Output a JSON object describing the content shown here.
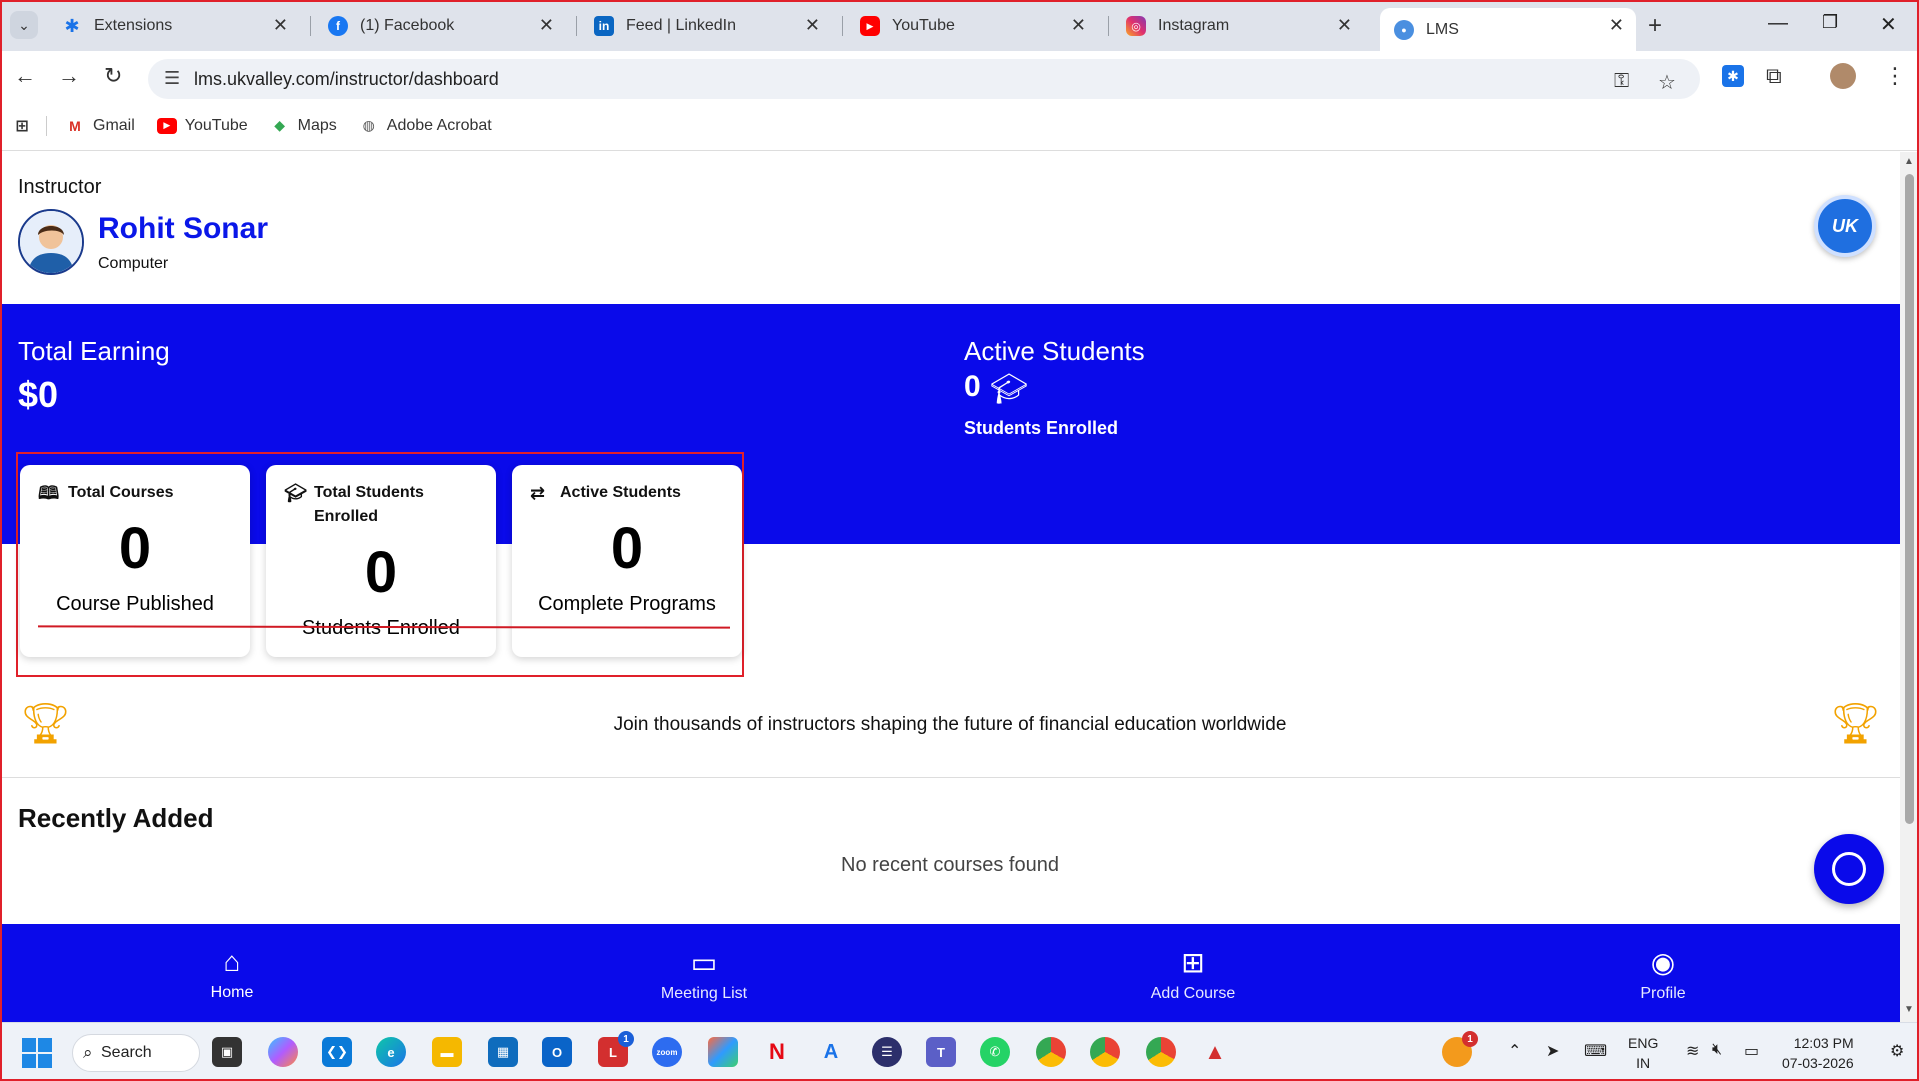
{
  "browser": {
    "tabs": [
      {
        "label": "Extensions"
      },
      {
        "label": "(1) Facebook"
      },
      {
        "label": "Feed | LinkedIn"
      },
      {
        "label": "YouTube"
      },
      {
        "label": "Instagram"
      },
      {
        "label": "LMS"
      }
    ],
    "url": "lms.ukvalley.com/instructor/dashboard",
    "bookmarks": [
      {
        "label": "Gmail"
      },
      {
        "label": "YouTube"
      },
      {
        "label": "Maps"
      },
      {
        "label": "Adobe Acrobat"
      }
    ]
  },
  "profile": {
    "role": "Instructor",
    "name": "Rohit Sonar",
    "department": "Computer"
  },
  "hero": {
    "earning_label": "Total Earning",
    "earning_value": "$0",
    "active_label": "Active Students",
    "active_value": "0",
    "active_sub": "Students Enrolled"
  },
  "cards": [
    {
      "title": "Total Courses",
      "value": "0",
      "subtitle": "Course Published"
    },
    {
      "title": "Total Students Enrolled",
      "value": "0",
      "subtitle": "Students Enrolled"
    },
    {
      "title": "Active Students",
      "value": "0",
      "subtitle": "Complete Programs"
    }
  ],
  "tagline": "Join thousands of instructors shaping the future of financial education worldwide",
  "recent": {
    "title": "Recently Added",
    "empty": "No recent courses found"
  },
  "bottom_nav": [
    {
      "label": "Home"
    },
    {
      "label": "Meeting List"
    },
    {
      "label": "Add Course"
    },
    {
      "label": "Profile"
    }
  ],
  "taskbar": {
    "search": "Search",
    "lang_top": "ENG",
    "lang_bottom": "IN",
    "time": "12:03 PM",
    "date": "07-03-2026",
    "notif_badge": "1",
    "lens_badge": "1"
  },
  "colors": {
    "brand_blue": "#0a0aea",
    "name_blue": "#0a17e8",
    "trophy": "#f2a200",
    "highlight_red": "#e0202a"
  }
}
